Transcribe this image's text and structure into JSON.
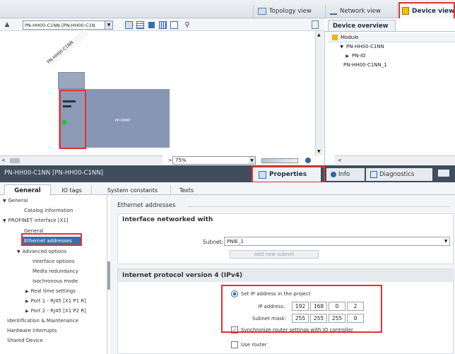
{
  "view_tabs": {
    "topology": "Topology view",
    "network": "Network view",
    "device": "Device view"
  },
  "toolbar": {
    "device_select": "PN-HH00-C1NN [PN-HH00-C1N"
  },
  "canvas": {
    "module_label": "PN-HH00-C1NN",
    "card_label": "PP-00MP",
    "zoom": "75%"
  },
  "overview": {
    "title": "Device overview",
    "column_module": "Module",
    "rows": [
      "PN-HH00-C1NN",
      "PN-IO",
      "PN-HH00-C1NN_1"
    ]
  },
  "props_header": {
    "device_title": "PN-HH00-C1NN [PN-HH00-C1NN]",
    "properties": "Properties",
    "info": "Info",
    "diagnostics": "Diagnostics"
  },
  "tabs": [
    "General",
    "IO tags",
    "System constants",
    "Texts"
  ],
  "nav": {
    "general": "General",
    "catalog": "Catalog information",
    "profinet": "PROFINET interface [X1]",
    "general2": "General",
    "ethernet": "Ethernet addresses",
    "advanced": "Advanced options",
    "interface_options": "Interface options",
    "media_redundancy": "Media redundancy",
    "isochronous": "Isochronous mode",
    "realtime": "Real time settings",
    "port1": "Port 1 - RJ45 [X1 P1 R]",
    "port2": "Port 2 - RJ45 [X1 P2 R]",
    "identification": "Identification & Maintenance",
    "hw_interrupts": "Hardware interrupts",
    "shared": "Shared Device"
  },
  "content": {
    "section_title": "Ethernet addresses",
    "iface_title": "Interface networked with",
    "subnet_label": "Subnet:",
    "subnet_value": "PNIE_1",
    "add_subnet": "Add new subnet",
    "ipv4_title": "Internet protocol version 4 (IPv4)",
    "set_ip_label": "Set IP address in the project",
    "ip_label": "IP address:",
    "ip_octets": [
      "192",
      "168",
      "0",
      "2"
    ],
    "mask_label": "Subnet mask:",
    "mask_octets": [
      "255",
      "255",
      "255",
      "0"
    ],
    "sync_router_label": "Synchronize router settings with IO controller",
    "use_router_label": "Use router"
  },
  "colors": {
    "accent_red": "#e0342f",
    "header_dark": "#3f4d5c",
    "device_body": "#8796b3"
  }
}
